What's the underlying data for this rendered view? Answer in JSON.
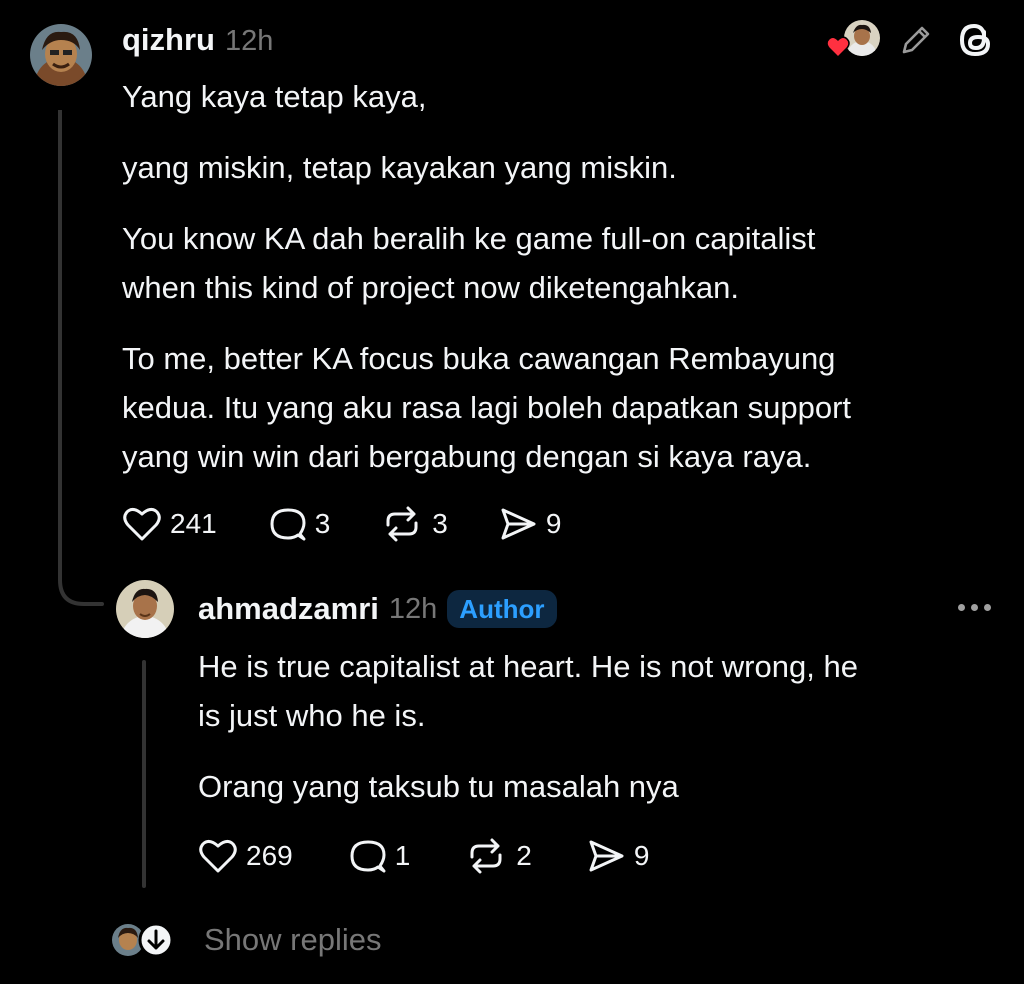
{
  "colors": {
    "background": "#000000",
    "text": "#f3f5f7",
    "muted": "#777777",
    "author_badge": "#2c9fff",
    "like_heart": "#ff3040"
  },
  "top_post": {
    "username": "qizhru",
    "time": "12h",
    "paragraphs": [
      [
        "Yang kaya tetap kaya,"
      ],
      [
        "yang miskin, tetap kayakan yang miskin."
      ],
      [
        "You know KA dah beralih ke game full-on capitalist",
        "when this kind of project now diketengahkan."
      ],
      [
        "To me, better KA focus buka cawangan Rembayung",
        "kedua. Itu yang aku rasa lagi boleh dapatkan support",
        "yang win win dari bergabung dengan si kaya raya."
      ]
    ],
    "likes": "241",
    "replies": "3",
    "reposts": "3",
    "shares": "9",
    "top_right_icons": [
      "liked-by-author-heart-icon",
      "edit-pencil-icon",
      "threads-logo-icon"
    ]
  },
  "reply": {
    "username": "ahmadzamri",
    "time": "12h",
    "badge": "Author",
    "paragraphs": [
      [
        "He is true capitalist at heart. He is not wrong, he",
        "is just who he is."
      ],
      [
        "Orang yang taksub tu masalah nya"
      ]
    ],
    "likes": "269",
    "replies": "1",
    "reposts": "2",
    "shares": "9"
  },
  "footer": {
    "show_replies": "Show replies"
  }
}
